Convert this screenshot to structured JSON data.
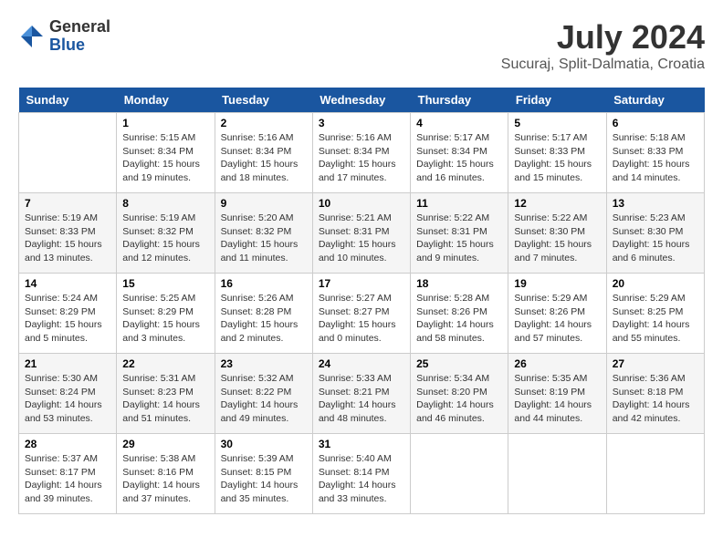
{
  "logo": {
    "general": "General",
    "blue": "Blue"
  },
  "title": "July 2024",
  "location": "Sucuraj, Split-Dalmatia, Croatia",
  "days": [
    "Sunday",
    "Monday",
    "Tuesday",
    "Wednesday",
    "Thursday",
    "Friday",
    "Saturday"
  ],
  "weeks": [
    [
      {
        "day": "",
        "content": ""
      },
      {
        "day": "1",
        "content": "Sunrise: 5:15 AM\nSunset: 8:34 PM\nDaylight: 15 hours\nand 19 minutes."
      },
      {
        "day": "2",
        "content": "Sunrise: 5:16 AM\nSunset: 8:34 PM\nDaylight: 15 hours\nand 18 minutes."
      },
      {
        "day": "3",
        "content": "Sunrise: 5:16 AM\nSunset: 8:34 PM\nDaylight: 15 hours\nand 17 minutes."
      },
      {
        "day": "4",
        "content": "Sunrise: 5:17 AM\nSunset: 8:34 PM\nDaylight: 15 hours\nand 16 minutes."
      },
      {
        "day": "5",
        "content": "Sunrise: 5:17 AM\nSunset: 8:33 PM\nDaylight: 15 hours\nand 15 minutes."
      },
      {
        "day": "6",
        "content": "Sunrise: 5:18 AM\nSunset: 8:33 PM\nDaylight: 15 hours\nand 14 minutes."
      }
    ],
    [
      {
        "day": "7",
        "content": "Sunrise: 5:19 AM\nSunset: 8:33 PM\nDaylight: 15 hours\nand 13 minutes."
      },
      {
        "day": "8",
        "content": "Sunrise: 5:19 AM\nSunset: 8:32 PM\nDaylight: 15 hours\nand 12 minutes."
      },
      {
        "day": "9",
        "content": "Sunrise: 5:20 AM\nSunset: 8:32 PM\nDaylight: 15 hours\nand 11 minutes."
      },
      {
        "day": "10",
        "content": "Sunrise: 5:21 AM\nSunset: 8:31 PM\nDaylight: 15 hours\nand 10 minutes."
      },
      {
        "day": "11",
        "content": "Sunrise: 5:22 AM\nSunset: 8:31 PM\nDaylight: 15 hours\nand 9 minutes."
      },
      {
        "day": "12",
        "content": "Sunrise: 5:22 AM\nSunset: 8:30 PM\nDaylight: 15 hours\nand 7 minutes."
      },
      {
        "day": "13",
        "content": "Sunrise: 5:23 AM\nSunset: 8:30 PM\nDaylight: 15 hours\nand 6 minutes."
      }
    ],
    [
      {
        "day": "14",
        "content": "Sunrise: 5:24 AM\nSunset: 8:29 PM\nDaylight: 15 hours\nand 5 minutes."
      },
      {
        "day": "15",
        "content": "Sunrise: 5:25 AM\nSunset: 8:29 PM\nDaylight: 15 hours\nand 3 minutes."
      },
      {
        "day": "16",
        "content": "Sunrise: 5:26 AM\nSunset: 8:28 PM\nDaylight: 15 hours\nand 2 minutes."
      },
      {
        "day": "17",
        "content": "Sunrise: 5:27 AM\nSunset: 8:27 PM\nDaylight: 15 hours\nand 0 minutes."
      },
      {
        "day": "18",
        "content": "Sunrise: 5:28 AM\nSunset: 8:26 PM\nDaylight: 14 hours\nand 58 minutes."
      },
      {
        "day": "19",
        "content": "Sunrise: 5:29 AM\nSunset: 8:26 PM\nDaylight: 14 hours\nand 57 minutes."
      },
      {
        "day": "20",
        "content": "Sunrise: 5:29 AM\nSunset: 8:25 PM\nDaylight: 14 hours\nand 55 minutes."
      }
    ],
    [
      {
        "day": "21",
        "content": "Sunrise: 5:30 AM\nSunset: 8:24 PM\nDaylight: 14 hours\nand 53 minutes."
      },
      {
        "day": "22",
        "content": "Sunrise: 5:31 AM\nSunset: 8:23 PM\nDaylight: 14 hours\nand 51 minutes."
      },
      {
        "day": "23",
        "content": "Sunrise: 5:32 AM\nSunset: 8:22 PM\nDaylight: 14 hours\nand 49 minutes."
      },
      {
        "day": "24",
        "content": "Sunrise: 5:33 AM\nSunset: 8:21 PM\nDaylight: 14 hours\nand 48 minutes."
      },
      {
        "day": "25",
        "content": "Sunrise: 5:34 AM\nSunset: 8:20 PM\nDaylight: 14 hours\nand 46 minutes."
      },
      {
        "day": "26",
        "content": "Sunrise: 5:35 AM\nSunset: 8:19 PM\nDaylight: 14 hours\nand 44 minutes."
      },
      {
        "day": "27",
        "content": "Sunrise: 5:36 AM\nSunset: 8:18 PM\nDaylight: 14 hours\nand 42 minutes."
      }
    ],
    [
      {
        "day": "28",
        "content": "Sunrise: 5:37 AM\nSunset: 8:17 PM\nDaylight: 14 hours\nand 39 minutes."
      },
      {
        "day": "29",
        "content": "Sunrise: 5:38 AM\nSunset: 8:16 PM\nDaylight: 14 hours\nand 37 minutes."
      },
      {
        "day": "30",
        "content": "Sunrise: 5:39 AM\nSunset: 8:15 PM\nDaylight: 14 hours\nand 35 minutes."
      },
      {
        "day": "31",
        "content": "Sunrise: 5:40 AM\nSunset: 8:14 PM\nDaylight: 14 hours\nand 33 minutes."
      },
      {
        "day": "",
        "content": ""
      },
      {
        "day": "",
        "content": ""
      },
      {
        "day": "",
        "content": ""
      }
    ]
  ]
}
